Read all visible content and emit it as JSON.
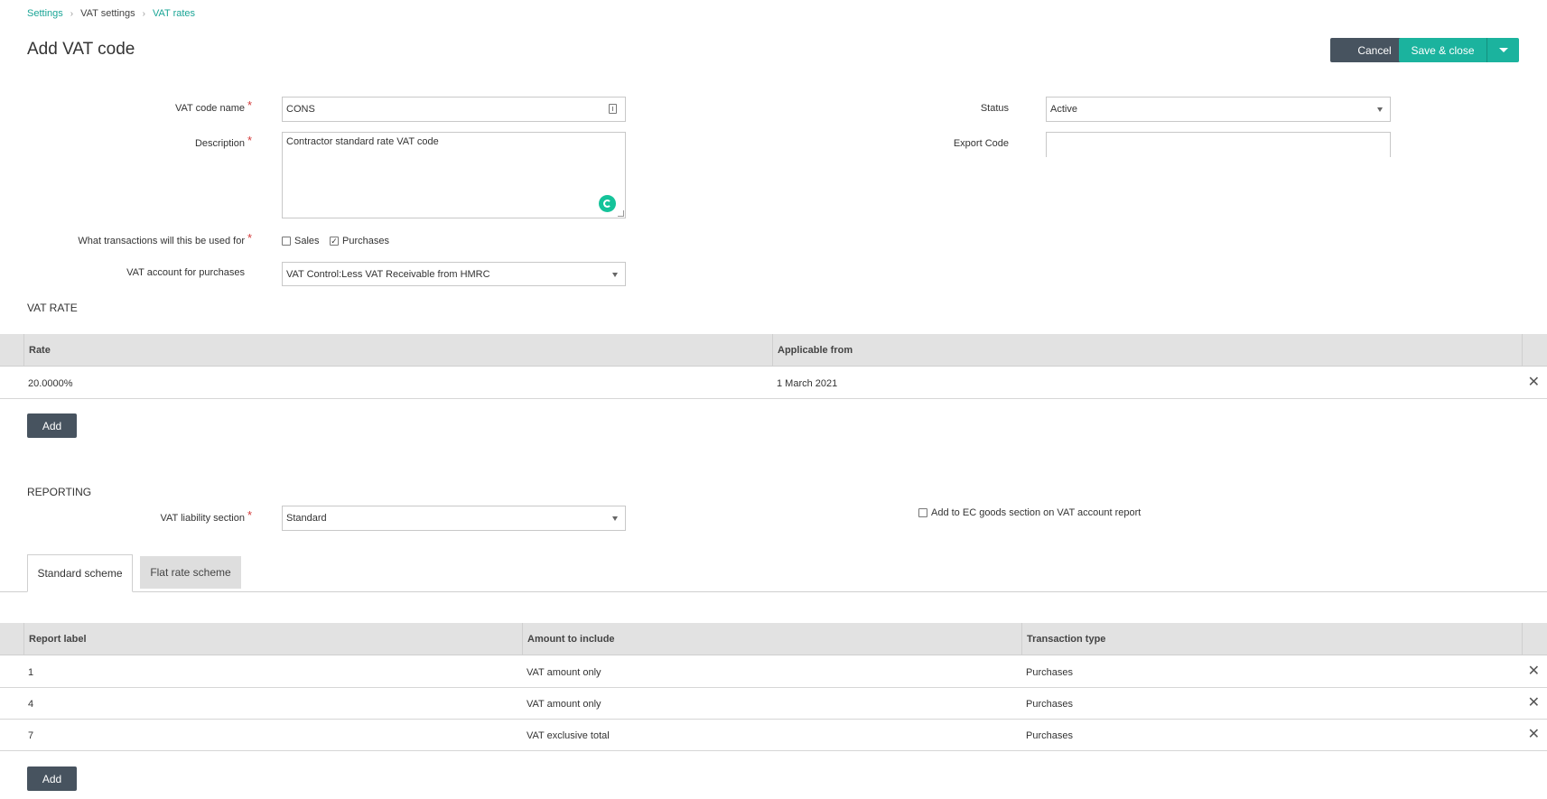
{
  "breadcrumb": {
    "items": [
      "Settings",
      "VAT settings",
      "VAT rates"
    ]
  },
  "page": {
    "title": "Add VAT code"
  },
  "header": {
    "cancel_label": "Cancel",
    "save_label": "Save & close"
  },
  "form": {
    "vat_code_name": {
      "label": "VAT code name",
      "value": "CONS"
    },
    "description": {
      "label": "Description",
      "value": "Contractor standard rate VAT code"
    },
    "transactions": {
      "label": "What transactions will this be used for",
      "sales_label": "Sales",
      "purchases_label": "Purchases",
      "sales_checked": false,
      "purchases_checked": true
    },
    "vat_account": {
      "label": "VAT account for purchases",
      "value": "VAT Control:Less VAT Receivable from HMRC"
    },
    "status": {
      "label": "Status",
      "value": "Active"
    },
    "export_code": {
      "label": "Export Code",
      "value": ""
    }
  },
  "vat_rate": {
    "title": "VAT RATE",
    "columns": [
      "Rate",
      "Applicable from"
    ],
    "rows": [
      {
        "rate": "20.0000%",
        "applicable_from": "1 March 2021"
      }
    ],
    "add_label": "Add"
  },
  "reporting": {
    "title": "REPORTING",
    "liability_label": "VAT liability section",
    "liability_value": "Standard",
    "ec_goods_label": "Add to EC goods section on VAT account report",
    "tabs": [
      "Standard scheme",
      "Flat rate scheme"
    ],
    "columns": [
      "Report label",
      "Amount to include",
      "Transaction type"
    ],
    "rows": [
      {
        "label": "1",
        "amount": "VAT amount only",
        "type": "Purchases"
      },
      {
        "label": "4",
        "amount": "VAT amount only",
        "type": "Purchases"
      },
      {
        "label": "7",
        "amount": "VAT exclusive total",
        "type": "Purchases"
      }
    ],
    "add_label": "Add"
  },
  "icons": {
    "delete": "close-icon",
    "grammarly": "grammarly-icon",
    "field_card": "contact-card-icon"
  }
}
